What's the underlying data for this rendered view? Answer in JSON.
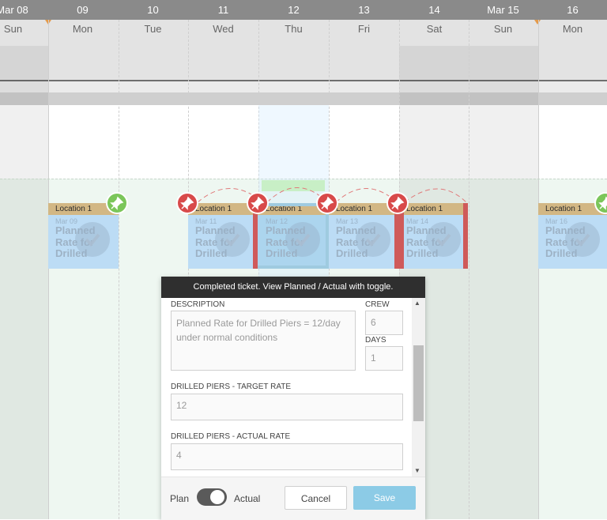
{
  "header": {
    "dates": [
      "Mar 08",
      "09",
      "10",
      "11",
      "12",
      "13",
      "14",
      "Mar 15",
      "16"
    ],
    "weekdays": [
      "Sun",
      "Mon",
      "Tue",
      "Wed",
      "Thu",
      "Fri",
      "Sat",
      "Sun",
      "Mon"
    ]
  },
  "cards": [
    {
      "location": "Location 1",
      "date": "Mar 09",
      "title": "Planned Rate for Drilled"
    },
    {
      "location": "Location 1",
      "date": "Mar 11",
      "title": "Planned Rate for Drilled"
    },
    {
      "location": "Location 1",
      "date": "Mar 12",
      "title": "Planned Rate for Drilled"
    },
    {
      "location": "Location 1",
      "date": "Mar 13",
      "title": "Planned Rate for Drilled"
    },
    {
      "location": "Location 1",
      "date": "Mar 14",
      "title": "Planned Rate for Drilled"
    },
    {
      "location": "Location 1",
      "date": "Mar 16",
      "title": "Planned Rate for Drilled"
    }
  ],
  "modal": {
    "title": "Completed ticket. View Planned / Actual with toggle.",
    "description_label": "DESCRIPTION",
    "description_value": "Planned Rate for Drilled Piers = 12/day under normal conditions",
    "crew_label": "CREW",
    "crew_value": "6",
    "days_label": "DAYS",
    "days_value": "1",
    "target_label": "DRILLED PIERS - TARGET RATE",
    "target_value": "12",
    "actual_label": "DRILLED PIERS - ACTUAL RATE",
    "actual_value": "4",
    "toggle_left": "Plan",
    "toggle_right": "Actual",
    "toggle_state": "Actual",
    "cancel_label": "Cancel",
    "save_label": "Save"
  },
  "colors": {
    "card_fill": "#bcdcf5",
    "card_header": "#d2b784",
    "pin_red": "#d84a4a",
    "pin_green": "#7bc65a",
    "save_button": "#8ccbe6"
  },
  "icons": [
    "pin-icon",
    "check-icon",
    "scroll-up-icon",
    "scroll-down-icon"
  ]
}
